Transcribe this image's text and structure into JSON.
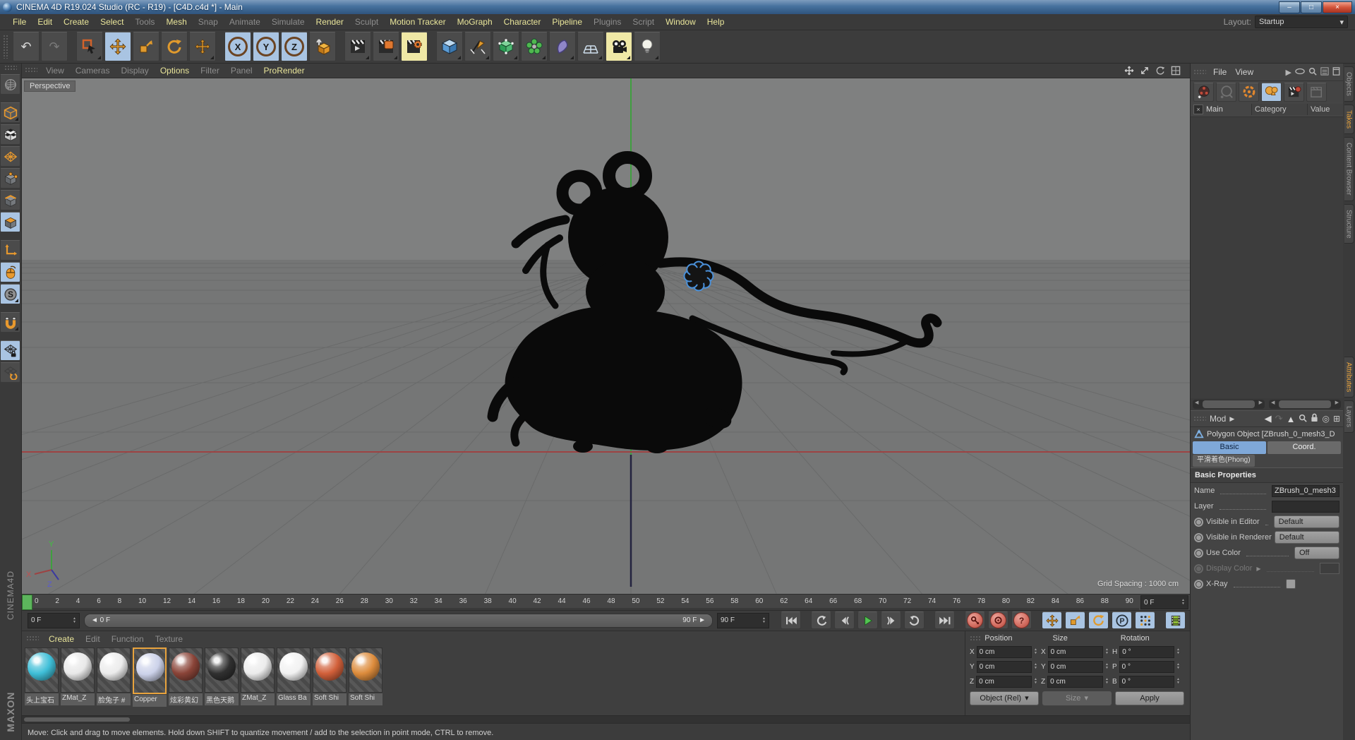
{
  "window": {
    "title": "CINEMA 4D R19.024 Studio (RC - R19) - [C4D.c4d *] - Main",
    "controls": {
      "minimize": "–",
      "maximize": "□",
      "close": "×"
    }
  },
  "menubar": {
    "items": [
      {
        "label": "File",
        "state": "active"
      },
      {
        "label": "Edit",
        "state": "active"
      },
      {
        "label": "Create",
        "state": "active"
      },
      {
        "label": "Select",
        "state": "active"
      },
      {
        "label": "Tools",
        "state": "dim"
      },
      {
        "label": "Mesh",
        "state": "active"
      },
      {
        "label": "Snap",
        "state": "dim"
      },
      {
        "label": "Animate",
        "state": "dim"
      },
      {
        "label": "Simulate",
        "state": "dim"
      },
      {
        "label": "Render",
        "state": "active"
      },
      {
        "label": "Sculpt",
        "state": "dim"
      },
      {
        "label": "Motion Tracker",
        "state": "active"
      },
      {
        "label": "MoGraph",
        "state": "active"
      },
      {
        "label": "Character",
        "state": "active"
      },
      {
        "label": "Pipeline",
        "state": "active"
      },
      {
        "label": "Plugins",
        "state": "dim"
      },
      {
        "label": "Script",
        "state": "dim"
      },
      {
        "label": "Window",
        "state": "active"
      },
      {
        "label": "Help",
        "state": "active"
      }
    ],
    "layout_label": "Layout:",
    "layout_value": "Startup"
  },
  "toolbar": {
    "axis_locks": [
      "X",
      "Y",
      "Z"
    ],
    "icons": [
      "undo",
      "redo",
      "live-selection",
      "move",
      "scale",
      "rotate",
      "last-tool",
      "lock-x",
      "lock-y",
      "lock-z",
      "coordinate-system",
      "render-view",
      "render-picture-viewer",
      "edit-render-settings",
      "add-primitive",
      "draw-spline",
      "subdivision-surface",
      "deformer",
      "simulate",
      "floor-environment",
      "add-camera",
      "add-light"
    ]
  },
  "left_toolbar": {
    "icons": [
      "make-editable",
      "model-mode",
      "texture-mode",
      "workplane-mode",
      "points-mode",
      "edges-mode",
      "polygons-mode",
      "object-axis-mode",
      "enable-axis-mode",
      "snap-settings",
      "enable-snap",
      "lock-workplane",
      "workplane-rotate"
    ]
  },
  "viewport": {
    "menu": [
      {
        "label": "View",
        "state": "dim"
      },
      {
        "label": "Cameras",
        "state": "dim"
      },
      {
        "label": "Display",
        "state": "dim"
      },
      {
        "label": "Options",
        "state": "active"
      },
      {
        "label": "Filter",
        "state": "dim"
      },
      {
        "label": "Panel",
        "state": "dim"
      },
      {
        "label": "ProRender",
        "state": "active"
      }
    ],
    "camera_label": "Perspective",
    "grid_spacing_label": "Grid Spacing : 1000 cm",
    "axis_labels": {
      "x": "X",
      "y": "Y",
      "z": "Z"
    },
    "nav_icons": [
      "pan-view",
      "zoom-view",
      "rotate-view",
      "toggle-views"
    ]
  },
  "timeline": {
    "ticks": [
      "0",
      "2",
      "4",
      "6",
      "8",
      "10",
      "12",
      "14",
      "16",
      "18",
      "20",
      "22",
      "24",
      "26",
      "28",
      "30",
      "32",
      "34",
      "36",
      "38",
      "40",
      "42",
      "44",
      "46",
      "48",
      "50",
      "52",
      "54",
      "56",
      "58",
      "60",
      "62",
      "64",
      "66",
      "68",
      "70",
      "72",
      "74",
      "76",
      "78",
      "80",
      "82",
      "84",
      "86",
      "88",
      "90"
    ],
    "frame_field": "0 F"
  },
  "transport": {
    "current_frame": "0 F",
    "range_start": "0 F",
    "range_end": "90 F",
    "end_frame_field": "90 F",
    "parameter_label": "P",
    "help_label": "?",
    "icons": [
      "go-to-start",
      "previous-key",
      "previous-frame",
      "play-forward",
      "next-frame",
      "next-key",
      "go-to-end",
      "record-keyframe",
      "autokeying",
      "keyframe-selection",
      "key-position",
      "key-scale",
      "key-rotation",
      "key-parameter",
      "key-pla",
      "timeline-window"
    ]
  },
  "materials": {
    "menu": [
      {
        "label": "Create",
        "state": "active"
      },
      {
        "label": "Edit",
        "state": "dim"
      },
      {
        "label": "Function",
        "state": "dim"
      },
      {
        "label": "Texture",
        "state": "dim"
      }
    ],
    "items": [
      {
        "name": "头上宝石",
        "color": "#3fbfd8",
        "selected": false
      },
      {
        "name": "ZMat_Z",
        "color": "#e9e9e9",
        "selected": false
      },
      {
        "name": "脸兔子 #",
        "color": "#ececec",
        "selected": false
      },
      {
        "name": "Copper",
        "color": "#ccd2ea",
        "selected": true
      },
      {
        "name": "炫彩黄幻",
        "color": "#8a4438",
        "selected": false
      },
      {
        "name": "黑色天鹅",
        "color": "#303030",
        "selected": false
      },
      {
        "name": "ZMat_Z",
        "color": "#ececec",
        "selected": false
      },
      {
        "name": "Glass Ba",
        "color": "#f2f2f2",
        "selected": false
      },
      {
        "name": "Soft Shi",
        "color": "#d2603a",
        "selected": false
      },
      {
        "name": "Soft Shi",
        "color": "#dd8c3c",
        "selected": false
      }
    ]
  },
  "coordinates": {
    "groups": [
      {
        "title": "Position",
        "rows": [
          {
            "axis": "X",
            "value": "0 cm"
          },
          {
            "axis": "Y",
            "value": "0 cm"
          },
          {
            "axis": "Z",
            "value": "0 cm"
          }
        ]
      },
      {
        "title": "Size",
        "rows": [
          {
            "axis": "X",
            "value": "0 cm"
          },
          {
            "axis": "Y",
            "value": "0 cm"
          },
          {
            "axis": "Z",
            "value": "0 cm"
          }
        ]
      },
      {
        "title": "Rotation",
        "rows": [
          {
            "axis": "H",
            "value": "0 °"
          },
          {
            "axis": "P",
            "value": "0 °"
          },
          {
            "axis": "B",
            "value": "0 °"
          }
        ]
      }
    ],
    "transform_mode": "Object (Rel)",
    "size_mode": "Size",
    "apply_label": "Apply"
  },
  "takes": {
    "menu": [
      {
        "label": "File",
        "state": "normal"
      },
      {
        "label": "View",
        "state": "normal"
      }
    ],
    "root_item": "Main",
    "columns": [
      "Category",
      "Value"
    ],
    "side_tabs": [
      {
        "label": "Objects",
        "active": false
      },
      {
        "label": "Takes",
        "active": true
      },
      {
        "label": "Content Browser",
        "active": false
      },
      {
        "label": "Structure",
        "active": false
      }
    ],
    "toolbar_icons": [
      "new-take",
      "auto-take",
      "override-mode",
      "take-spheres",
      "render-marked-takes",
      "render-all-takes"
    ]
  },
  "attributes": {
    "mode_label": "Mod",
    "title": "Polygon Object [ZBrush_0_mesh3_D",
    "tabs": [
      {
        "label": "Basic",
        "active": true
      },
      {
        "label": "Coord.",
        "active": false
      }
    ],
    "shading_tab": "平滑着色(Phong)",
    "section_title": "Basic Properties",
    "fields": [
      {
        "label": "Name",
        "value": "ZBrush_0_mesh3"
      },
      {
        "label": "Layer",
        "value": ""
      },
      {
        "label": "Visible in Editor",
        "value": "Default"
      },
      {
        "label": "Visible in Renderer",
        "value": "Default"
      },
      {
        "label": "Use Color",
        "value": "Off"
      },
      {
        "label": "Display Color",
        "value": ""
      },
      {
        "label": "X-Ray",
        "value": ""
      }
    ],
    "side_tabs": [
      {
        "label": "Attributes",
        "active": true
      },
      {
        "label": "Layers",
        "active": false
      }
    ]
  },
  "statusbar": {
    "text": "Move: Click and drag to move elements. Hold down SHIFT to quantize movement / add to the selection in point mode, CTRL to remove."
  },
  "branding": {
    "company": "MAXON",
    "app": "CINEMA4D"
  },
  "colors": {
    "accent_blue": "#a9c4e2",
    "accent_yellow": "#efe8a6",
    "accent_orange": "#e8a33d",
    "axis_green": "#3f9f3f",
    "axis_red": "#9d4343",
    "axis_blue": "#23233f",
    "selection_highlight": "#4a90d9",
    "play_green": "#52c452"
  }
}
